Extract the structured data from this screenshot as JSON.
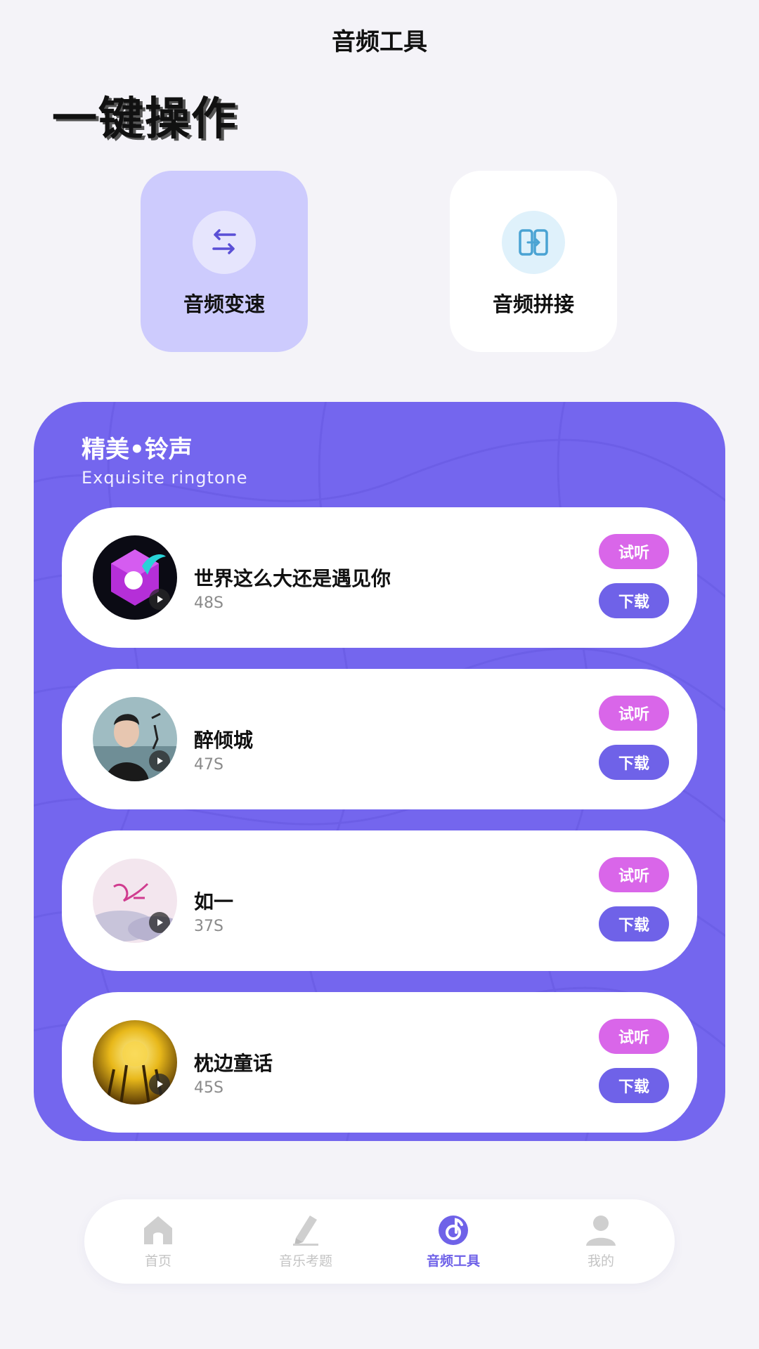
{
  "header": {
    "title": "音频工具"
  },
  "section": {
    "title": "一键操作"
  },
  "tools": [
    {
      "label": "音频变速",
      "icon": "swap-arrows-icon"
    },
    {
      "label": "音频拼接",
      "icon": "split-merge-icon"
    }
  ],
  "ringtones": {
    "title": "精美•铃声",
    "subtitle": "Exquisite ringtone",
    "items": [
      {
        "name": "世界这么大还是遇见你",
        "duration": "48S",
        "listen_label": "试听",
        "download_label": "下载"
      },
      {
        "name": "醉倾城",
        "duration": "47S",
        "listen_label": "试听",
        "download_label": "下载"
      },
      {
        "name": "如一",
        "duration": "37S",
        "listen_label": "试听",
        "download_label": "下载"
      },
      {
        "name": "枕边童话",
        "duration": "45S",
        "listen_label": "试听",
        "download_label": "下载"
      }
    ]
  },
  "tabbar": {
    "items": [
      {
        "label": "首页",
        "icon": "home-icon",
        "active": false
      },
      {
        "label": "音乐考题",
        "icon": "pencil-icon",
        "active": false
      },
      {
        "label": "音频工具",
        "icon": "music-disc-icon",
        "active": true
      },
      {
        "label": "我的",
        "icon": "user-icon",
        "active": false
      }
    ]
  },
  "colors": {
    "accent": "#6f62e8",
    "panel": "#7466ee",
    "listen": "#d966e9",
    "speed_card": "#cdcbfd"
  }
}
